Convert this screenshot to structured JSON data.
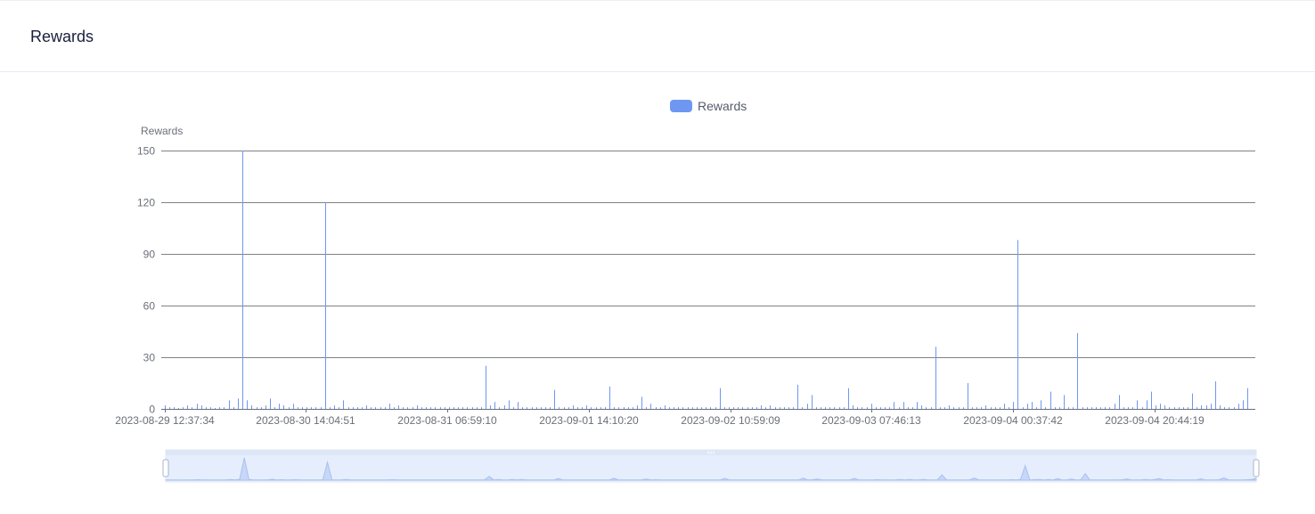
{
  "header": {
    "title": "Rewards"
  },
  "legend": {
    "label": "Rewards",
    "color": "#6e97f2"
  },
  "chart_data": {
    "type": "bar",
    "ylabel": "Rewards",
    "ylim": [
      0,
      150
    ],
    "yticks": [
      0,
      30,
      60,
      90,
      120,
      150
    ],
    "x_tick_labels": [
      "2023-08-29 12:37:34",
      "2023-08-30 14:04:51",
      "2023-08-31 06:59:10",
      "2023-09-01 14:10:20",
      "2023-09-02 10:59:09",
      "2023-09-03 07:46:13",
      "2023-09-04 00:37:42",
      "2023-09-04 20:44:19"
    ],
    "series": [
      {
        "name": "Rewards",
        "values": [
          2,
          1,
          1,
          0.5,
          1,
          2,
          1,
          3,
          2,
          1,
          1,
          0.5,
          1,
          1,
          5,
          1,
          6,
          150,
          5,
          2,
          1,
          1,
          2,
          6,
          1,
          3,
          2,
          1,
          3,
          1,
          1,
          1,
          1,
          1,
          1,
          120,
          1,
          2,
          1,
          5,
          1,
          1,
          1,
          1,
          2,
          1,
          1,
          1,
          1,
          3,
          1,
          2,
          1,
          1,
          1,
          2,
          1,
          1,
          1,
          1,
          1,
          1,
          1,
          1,
          1,
          1,
          1,
          1,
          1,
          1,
          25,
          2,
          4,
          1,
          2,
          5,
          1,
          4,
          1,
          1,
          1,
          1,
          1,
          1,
          1,
          11,
          1,
          1,
          1,
          2,
          1,
          1,
          2,
          1,
          1,
          1,
          1,
          13,
          1,
          1,
          1,
          1,
          1,
          2,
          7,
          1,
          3,
          1,
          1,
          2,
          1,
          1,
          1,
          1,
          1,
          1,
          1,
          1,
          1,
          1,
          1,
          12,
          1,
          1,
          1,
          1,
          1,
          1,
          1,
          1,
          2,
          1,
          2,
          1,
          1,
          1,
          1,
          1,
          14,
          1,
          3,
          8,
          1,
          1,
          1,
          1,
          1,
          1,
          1,
          12,
          2,
          1,
          1,
          1,
          3,
          1,
          1,
          1,
          1,
          4,
          1,
          4,
          1,
          1,
          4,
          2,
          1,
          1,
          36,
          1,
          1,
          2,
          1,
          1,
          1,
          15,
          1,
          1,
          1,
          2,
          1,
          1,
          1,
          3,
          1,
          4,
          98,
          1,
          3,
          4,
          1,
          5,
          1,
          10,
          1,
          1,
          8,
          1,
          1,
          44,
          1,
          1,
          1,
          1,
          1,
          1,
          1,
          3,
          8,
          1,
          1,
          1,
          5,
          1,
          5,
          10,
          2,
          3,
          2,
          1,
          1,
          1,
          1,
          1,
          9,
          1,
          2,
          2,
          3,
          16,
          2,
          1,
          1,
          1,
          3,
          5,
          12
        ]
      }
    ],
    "grid": true,
    "legend_position": "top-center",
    "data_zoom_slider": true
  }
}
